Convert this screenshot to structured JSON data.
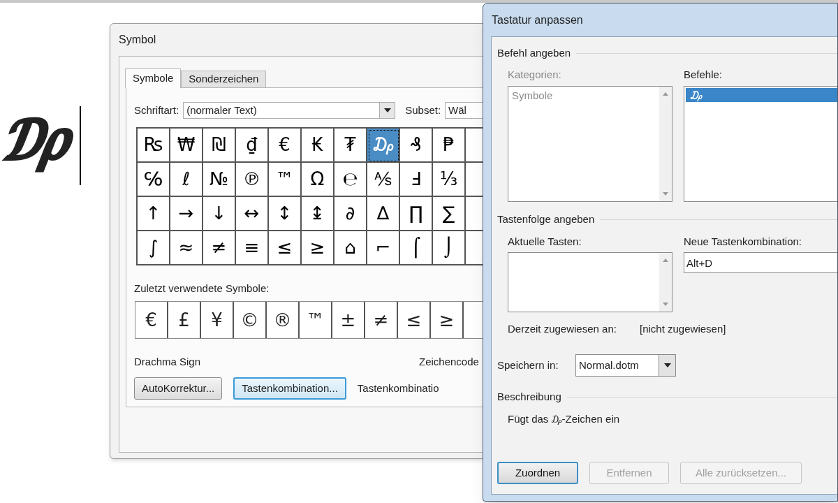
{
  "document": {
    "text": "₯"
  },
  "symbol_dialog": {
    "title": "Symbol",
    "tabs": [
      {
        "label": "Symbole",
        "selected": true
      },
      {
        "label": "Sonderzeichen",
        "selected": false
      }
    ],
    "font_label": "Schriftart:",
    "font_value": "(normaler Text)",
    "subset_label": "Subset:",
    "subset_value": "Wäl",
    "symbols": [
      [
        {
          "char": "₨",
          "selected": false
        },
        {
          "char": "₩",
          "selected": false
        },
        {
          "char": "₪",
          "selected": false
        },
        {
          "char": "₫",
          "selected": false
        },
        {
          "char": "€",
          "selected": false
        },
        {
          "char": "₭",
          "selected": false
        },
        {
          "char": "₮",
          "selected": false
        },
        {
          "char": "₯",
          "selected": true
        },
        {
          "char": "₰",
          "selected": false
        },
        {
          "char": "₱",
          "selected": false
        }
      ],
      [
        {
          "char": "℅",
          "selected": false
        },
        {
          "char": "ℓ",
          "selected": false
        },
        {
          "char": "№",
          "selected": false
        },
        {
          "char": "℗",
          "selected": false
        },
        {
          "char": "™",
          "selected": false
        },
        {
          "char": "Ω",
          "selected": false
        },
        {
          "char": "℮",
          "selected": false
        },
        {
          "char": "⅍",
          "selected": false
        },
        {
          "char": "Ⅎ",
          "selected": false
        },
        {
          "char": "⅓",
          "selected": false
        }
      ],
      [
        {
          "char": "↑",
          "selected": false
        },
        {
          "char": "→",
          "selected": false
        },
        {
          "char": "↓",
          "selected": false
        },
        {
          "char": "↔",
          "selected": false
        },
        {
          "char": "↕",
          "selected": false
        },
        {
          "char": "↨",
          "selected": false
        },
        {
          "char": "∂",
          "selected": false
        },
        {
          "char": "∆",
          "selected": false
        },
        {
          "char": "∏",
          "selected": false
        },
        {
          "char": "∑",
          "selected": false
        }
      ],
      [
        {
          "char": "∫",
          "selected": false
        },
        {
          "char": "≈",
          "selected": false
        },
        {
          "char": "≠",
          "selected": false
        },
        {
          "char": "≡",
          "selected": false
        },
        {
          "char": "≤",
          "selected": false
        },
        {
          "char": "≥",
          "selected": false
        },
        {
          "char": "⌂",
          "selected": false
        },
        {
          "char": "⌐",
          "selected": false
        },
        {
          "char": "⌠",
          "selected": false
        },
        {
          "char": "⌡",
          "selected": false
        }
      ]
    ],
    "recent_label": "Zuletzt verwendete Symbole:",
    "recent": [
      "€",
      "£",
      "¥",
      "©",
      "®",
      "™",
      "±",
      "≠",
      "≤",
      "≥"
    ],
    "char_name": "Drachma Sign",
    "code_label": "Zeichencode",
    "buttons": [
      {
        "label": "AutoKorrektur...",
        "focused": false
      },
      {
        "label": "Tastenkombination...",
        "focused": true
      }
    ],
    "shortcut_label": "Tastenkombinatio"
  },
  "keyboard_dialog": {
    "title": "Tastatur anpassen",
    "command_group": "Befehl angeben",
    "categories": {
      "label": "Kategorien:",
      "disabled": true,
      "items": [
        {
          "label": "Symbole",
          "selected": false
        }
      ]
    },
    "commands": {
      "label": "Befehle:",
      "items": [
        {
          "label": "₯",
          "selected": true
        }
      ]
    },
    "keys_group": "Tastenfolge angeben",
    "current_keys": {
      "label": "Aktuelle Tasten:"
    },
    "new_shortcut": {
      "label": "Neue Tastenkombination:",
      "value": "Alt+D"
    },
    "assigned_label": "Derzeit zugewiesen an:",
    "assigned_value": "[nicht zugewiesen]",
    "save_in": {
      "label": "Speichern in:",
      "value": "Normal.dotm"
    },
    "description_group": "Beschreibung",
    "description": "Fügt das ₯-Zeichen ein",
    "buttons": [
      {
        "label": "Zuordnen",
        "disabled": false,
        "default": true
      },
      {
        "label": "Entfernen",
        "disabled": true,
        "default": false
      },
      {
        "label": "Alle zurücksetzen...",
        "disabled": true,
        "default": false
      }
    ]
  }
}
